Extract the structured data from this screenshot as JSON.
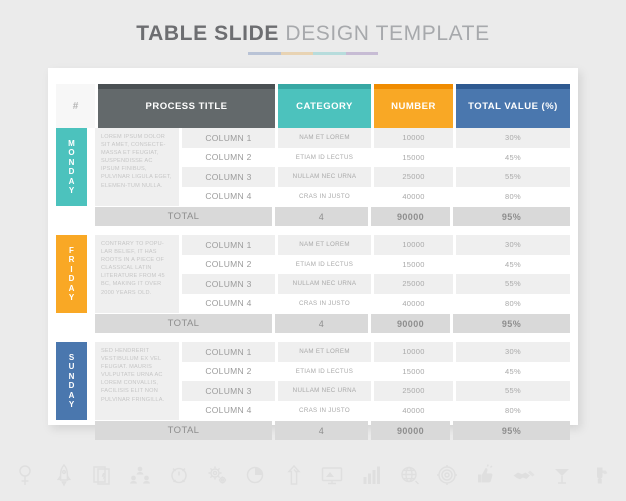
{
  "title": {
    "bold_part": "TABLE  SLIDE",
    "light_part": " DESIGN TEMPLATE",
    "rule_colors": [
      "#b9c3d6",
      "#e8d3b3",
      "#b7dcdc",
      "#c7bcd4"
    ]
  },
  "table": {
    "headers": {
      "index": "#",
      "process_title": "PROCESS TITLE",
      "category": "CATEGORY",
      "number": "NUMBER",
      "total_value": "TOTAL VALUE (%)"
    },
    "header_colors": {
      "process_title": "#63696b",
      "category": "#4cc2bd",
      "number": "#f9a825",
      "total_value": "#4a77ae"
    },
    "total_label": "TOTAL",
    "blocks": [
      {
        "day": "MONDAY",
        "day_letters": [
          "M",
          "O",
          "N",
          "D",
          "A",
          "Y"
        ],
        "accent": "#4cc2bd",
        "description": "LOREM IPSUM DOLOR SIT AMET, CONSECTE-MASSA ET FEUGIAT, SUSPENDISSE AC IPSUM FINIBUS, PULVINAR LIGULA EGET, ELEMEN-TUM NULLA.",
        "rows": [
          {
            "column": "COLUMN 1",
            "category": "NAM ET LOREM",
            "number": "10000",
            "total": "30%"
          },
          {
            "column": "COLUMN 2",
            "category": "ETIAM ID LECTUS",
            "number": "15000",
            "total": "45%"
          },
          {
            "column": "COLUMN 3",
            "category": "NULLAM NEC URNA",
            "number": "25000",
            "total": "55%"
          },
          {
            "column": "COLUMN 4",
            "category": "CRAS IN JUSTO",
            "number": "40000",
            "total": "80%"
          }
        ],
        "totals": {
          "category": "4",
          "number": "90000",
          "total": "95%"
        }
      },
      {
        "day": "FRIDAY",
        "day_letters": [
          "F",
          "R",
          "I",
          "D",
          "A",
          "Y"
        ],
        "accent": "#f9a825",
        "description": "CONTRARY TO POPU-LAR BELIEF, IT HAS ROOTS IN A PIECE OF CLASSICAL LATIN LITERATURE FROM 45 BC, MAKING IT OVER 2000 YEARS OLD.",
        "rows": [
          {
            "column": "COLUMN 1",
            "category": "NAM ET LOREM",
            "number": "10000",
            "total": "30%"
          },
          {
            "column": "COLUMN 2",
            "category": "ETIAM ID LECTUS",
            "number": "15000",
            "total": "45%"
          },
          {
            "column": "COLUMN 3",
            "category": "NULLAM NEC URNA",
            "number": "25000",
            "total": "55%"
          },
          {
            "column": "COLUMN 4",
            "category": "CRAS IN JUSTO",
            "number": "40000",
            "total": "80%"
          }
        ],
        "totals": {
          "category": "4",
          "number": "90000",
          "total": "95%"
        }
      },
      {
        "day": "SUNDAY",
        "day_letters": [
          "S",
          "U",
          "N",
          "D",
          "A",
          "Y"
        ],
        "accent": "#4a77ae",
        "description": "SED HENDRERIT VESTIBULUM EX VEL FEUGIAT. MAURIS VULPUTATE URNA AC LOREM CONVALLIS, FACILISIS ELIT NON PULVINAR FRINGILLA.",
        "rows": [
          {
            "column": "COLUMN 1",
            "category": "NAM ET LOREM",
            "number": "10000",
            "total": "30%"
          },
          {
            "column": "COLUMN 2",
            "category": "ETIAM ID LECTUS",
            "number": "15000",
            "total": "45%"
          },
          {
            "column": "COLUMN 3",
            "category": "NULLAM NEC URNA",
            "number": "25000",
            "total": "55%"
          },
          {
            "column": "COLUMN 4",
            "category": "CRAS IN JUSTO",
            "number": "40000",
            "total": "80%"
          }
        ],
        "totals": {
          "category": "4",
          "number": "90000",
          "total": "95%"
        }
      }
    ]
  },
  "icon_strip": {
    "color": "#e0e0e0",
    "icons": [
      "location-pin-icon",
      "rocket-icon",
      "note-card-icon",
      "org-chart-icon",
      "alarm-clock-icon",
      "gears-icon",
      "pie-chart-icon",
      "up-arrow-icon",
      "presentation-monitor-icon",
      "bar-chart-icon",
      "globe-icon",
      "target-icon",
      "thumbs-up-icon",
      "handshake-icon",
      "cocktail-glass-icon",
      "trophy-hand-icon"
    ]
  }
}
